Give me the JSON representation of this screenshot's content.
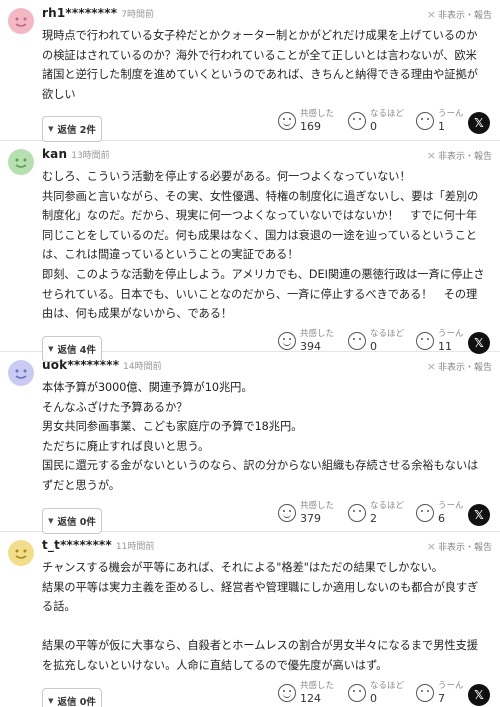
{
  "ui": {
    "report_label": "非表示・報告",
    "reaction_labels": [
      "共感した",
      "なるほど",
      "うーん"
    ],
    "x_icon": "x-logo"
  },
  "comments": [
    {
      "user": "rh1********",
      "time": "7時間前",
      "avatar_color": "#f4b8c4",
      "text": "現時点で行われている女子枠だとかクォーター制とかがどれだけ成果を上げているのかの検証はされているのか？海外で行われていることが全て正しいとは言わないが、欧米諸国と逆行した制度を進めていくというのであれば、きちんと納得できる理由や証拠が欲しい",
      "reply": "返信 2件",
      "counts": [
        "169",
        "0",
        "1"
      ]
    },
    {
      "user": "kan",
      "time": "13時間前",
      "avatar_color": "#b7e0b0",
      "text": "むしろ、こういう活動を停止する必要がある。何一つよくなっていない！\n共同参画と言いながら、その実、女性優遇、特権の制度化に過ぎないし、要は「差別の制度化」なのだ。だから、現実に何一つよくなっていないではないか！　すでに何十年同じことをしているのだ。何も成果はなく、国力は衰退の一途を辿っているということは、これは間違っているということの実証である！\n即刻、このような活動を停止しよう。アメリカでも、DEI関連の悪徳行政は一斉に停止させられている。日本でも、いいことなのだから、一斉に停止するべきである！　その理由は、何も成果がないから、である！",
      "reply": "返信 4件",
      "counts": [
        "394",
        "0",
        "11"
      ]
    },
    {
      "user": "uok********",
      "time": "14時間前",
      "avatar_color": "#c9cbf2",
      "text": "本体予算が3000億、関連予算が10兆円。\nそんなふざけた予算あるか？\n男女共同参画事業、こども家庭庁の予算で18兆円。\nただちに廃止すれば良いと思う。\n国民に還元する金がないというのなら、訳の分からない組織も存続させる余裕もないはずだと思うが。",
      "reply": "返信 0件",
      "counts": [
        "379",
        "2",
        "6"
      ]
    },
    {
      "user": "t_t********",
      "time": "11時間前",
      "avatar_color": "#f2dd8a",
      "text": "チャンスする機会が平等にあれば、それによる\"格差\"はただの結果でしかない。\n結果の平等は実力主義を歪めるし、経営者や管理職にしか適用しないのも都合が良すぎる話。\n\n結果の平等が仮に大事なら、自殺者とホームレスの割合が男女半々になるまで男性支援を拡充しないといけない。人命に直結してるので優先度が高いはず。",
      "reply": "返信 0件",
      "counts": [
        "124",
        "0",
        "7"
      ]
    }
  ]
}
